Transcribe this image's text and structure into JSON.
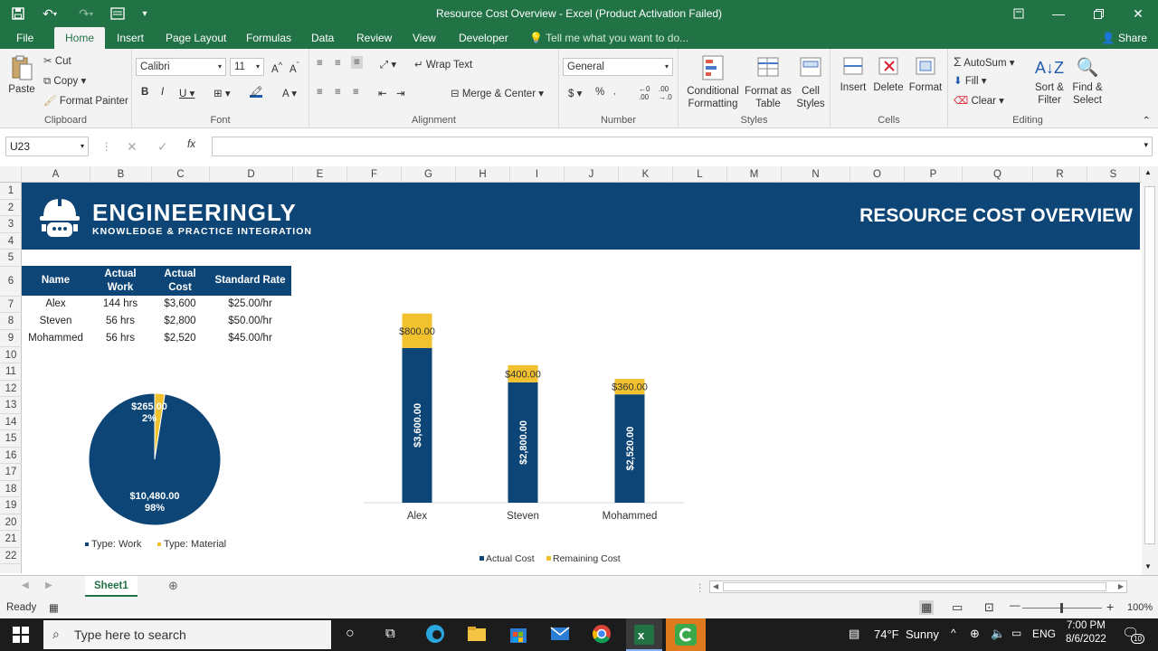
{
  "window": {
    "title": "Resource Cost Overview - Excel (Product Activation Failed)"
  },
  "menu_tabs": [
    "File",
    "Home",
    "Insert",
    "Page Layout",
    "Formulas",
    "Data",
    "Review",
    "View",
    "Developer"
  ],
  "tell_me": "Tell me what you want to do...",
  "share": "Share",
  "ribbon": {
    "clipboard": {
      "paste": "Paste",
      "cut": "Cut",
      "copy": "Copy",
      "format_painter": "Format Painter",
      "label": "Clipboard"
    },
    "font": {
      "family": "Calibri",
      "size": "11",
      "label": "Font"
    },
    "alignment": {
      "wrap": "Wrap Text",
      "merge": "Merge & Center",
      "label": "Alignment"
    },
    "number": {
      "format": "General",
      "label": "Number"
    },
    "styles": {
      "conditional": "Conditional Formatting",
      "format_table": "Format as Table",
      "cell_styles": "Cell Styles",
      "label": "Styles"
    },
    "cells": {
      "insert": "Insert",
      "delete": "Delete",
      "format": "Format",
      "label": "Cells"
    },
    "editing": {
      "autosum": "AutoSum",
      "fill": "Fill",
      "clear": "Clear",
      "sort": "Sort & Filter",
      "find": "Find & Select",
      "label": "Editing"
    }
  },
  "formula_bar": {
    "name_box": "U23",
    "fx": "fx",
    "content": ""
  },
  "columns": [
    "A",
    "B",
    "C",
    "D",
    "E",
    "F",
    "G",
    "H",
    "I",
    "J",
    "K",
    "L",
    "M",
    "N",
    "O",
    "P",
    "Q",
    "R",
    "S"
  ],
  "rows": [
    "1",
    "2",
    "3",
    "4",
    "5",
    "6",
    "7",
    "8",
    "9",
    "10",
    "11",
    "12",
    "13",
    "14",
    "15",
    "16",
    "17",
    "18",
    "19",
    "20",
    "21",
    "22"
  ],
  "banner": {
    "brand": "ENGINEERINGLY",
    "tagline": "KNOWLEDGE & PRACTICE INTEGRATION",
    "title": "RESOURCE COST OVERVIEW",
    "color": "#0d4576"
  },
  "table": {
    "headers": [
      "Name",
      "Actual Work",
      "Actual Cost",
      "Standard Rate"
    ],
    "rows": [
      [
        "Alex",
        "144 hrs",
        "$3,600",
        "$25.00/hr"
      ],
      [
        "Steven",
        "56 hrs",
        "$2,800",
        "$50.00/hr"
      ],
      [
        "Mohammed",
        "56 hrs",
        "$2,520",
        "$45.00/hr"
      ]
    ]
  },
  "chart_data": [
    {
      "type": "pie",
      "slices": [
        {
          "name": "Type: Work",
          "value": 10480,
          "label": "$10,480.00",
          "percent": "98%",
          "color": "#0d4576"
        },
        {
          "name": "Type: Material",
          "value": 265,
          "label": "$265.00",
          "percent": "2%",
          "color": "#f2c12e"
        }
      ],
      "legend": "bottom"
    },
    {
      "type": "bar",
      "stacked": true,
      "categories": [
        "Alex",
        "Steven",
        "Mohammed"
      ],
      "series": [
        {
          "name": "Actual Cost",
          "values": [
            3600,
            2800,
            2520
          ],
          "labels": [
            "$3,600.00",
            "$2,800.00",
            "$2,520.00"
          ],
          "color": "#0d4576"
        },
        {
          "name": "Remaining Cost",
          "values": [
            800,
            400,
            360
          ],
          "labels": [
            "$800.00",
            "$400.00",
            "$360.00"
          ],
          "color": "#f2c12e"
        }
      ],
      "ylim": [
        0,
        4900
      ],
      "legend": "bottom"
    }
  ],
  "sheet_tab": "Sheet1",
  "status": {
    "ready": "Ready",
    "zoom": "100%"
  },
  "taskbar": {
    "search": "Type here to search",
    "weather_temp": "74°F",
    "weather_text": "Sunny",
    "lang": "ENG",
    "time": "7:00 PM",
    "date": "8/6/2022",
    "notifications": "10"
  }
}
